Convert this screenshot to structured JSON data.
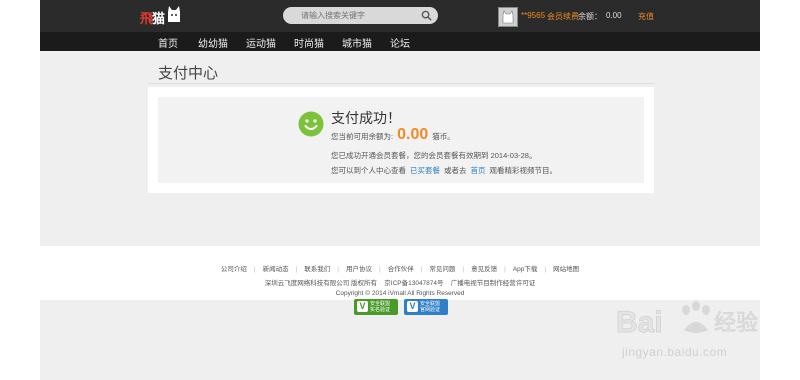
{
  "header": {
    "logo": {
      "part1": "飛",
      "part2": "猫"
    },
    "search_placeholder": "请输入搜索关键字",
    "username": "**9565",
    "member_link": "会员续费",
    "balance_label": "余额：",
    "balance_value": "0.00",
    "recharge": "充值"
  },
  "nav": {
    "items": [
      "首页",
      "幼幼猫",
      "运动猫",
      "时尚猫",
      "城市猫",
      "论坛"
    ]
  },
  "page": {
    "title": "支付中心"
  },
  "result": {
    "title": "支付成功！",
    "balance_prefix": "您当前可用余额为:",
    "balance_amount": "0.00",
    "balance_unit": "猫币。",
    "expiry_text": "您已成功开通会员套餐，您的会员套餐有效期到",
    "expiry_date": "2014-03-28。",
    "view_prefix": "您可以到个人中心查看",
    "view_link": "已买套餐",
    "view_mid": "或者去",
    "home_link": "首页",
    "view_suffix": "观看精彩视频节目。"
  },
  "footer": {
    "links": [
      "公司介绍",
      "新闻动态",
      "联系我们",
      "用户协议",
      "合作伙伴",
      "常见问题",
      "意见反馈",
      "App下载",
      "网站地图"
    ],
    "company_line": "深圳云飞度网络科技有限公司 版权所有",
    "icp": "京ICP备13047874号",
    "license": "广播电视节目制作经营许可证",
    "copyright": "Copyright © 2014 iVmall All Rights Reserved",
    "badge1": "安全联盟 实名验证",
    "badge2": "安全联盟 官网验证"
  },
  "watermark": {
    "text": "jingyan.baidu.com"
  },
  "colors": {
    "accent": "#f08a24",
    "link": "#2f7fc8",
    "success": "#7cc23a",
    "topbar": "#2b2b2b"
  }
}
